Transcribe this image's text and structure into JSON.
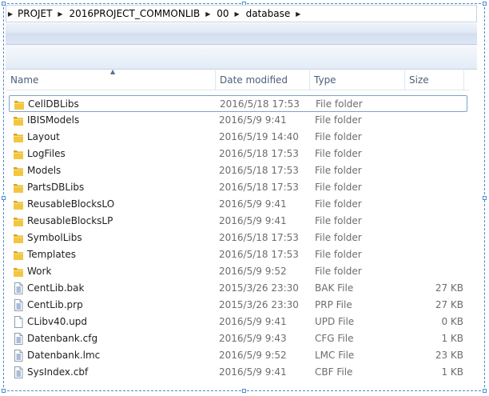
{
  "breadcrumb": [
    {
      "label": "PROJET"
    },
    {
      "label": "2016PROJECT_COMMONLIB"
    },
    {
      "label": "00"
    },
    {
      "label": "database"
    }
  ],
  "columns": {
    "name": "Name",
    "date": "Date modified",
    "type": "Type",
    "size": "Size"
  },
  "files": [
    {
      "name": "CellDBLibs",
      "date": "2016/5/18 17:53",
      "type": "File folder",
      "size": "",
      "icon": "folder-icon"
    },
    {
      "name": "IBISModels",
      "date": "2016/5/9 9:41",
      "type": "File folder",
      "size": "",
      "icon": "folder-icon"
    },
    {
      "name": "Layout",
      "date": "2016/5/19 14:40",
      "type": "File folder",
      "size": "",
      "icon": "folder-icon"
    },
    {
      "name": "LogFiles",
      "date": "2016/5/18 17:53",
      "type": "File folder",
      "size": "",
      "icon": "folder-icon"
    },
    {
      "name": "Models",
      "date": "2016/5/18 17:53",
      "type": "File folder",
      "size": "",
      "icon": "folder-icon"
    },
    {
      "name": "PartsDBLibs",
      "date": "2016/5/18 17:53",
      "type": "File folder",
      "size": "",
      "icon": "folder-icon"
    },
    {
      "name": "ReusableBlocksLO",
      "date": "2016/5/9 9:41",
      "type": "File folder",
      "size": "",
      "icon": "folder-icon"
    },
    {
      "name": "ReusableBlocksLP",
      "date": "2016/5/9 9:41",
      "type": "File folder",
      "size": "",
      "icon": "folder-icon"
    },
    {
      "name": "SymbolLibs",
      "date": "2016/5/18 17:53",
      "type": "File folder",
      "size": "",
      "icon": "folder-icon"
    },
    {
      "name": "Templates",
      "date": "2016/5/18 17:53",
      "type": "File folder",
      "size": "",
      "icon": "folder-icon"
    },
    {
      "name": "Work",
      "date": "2016/5/9 9:52",
      "type": "File folder",
      "size": "",
      "icon": "folder-icon"
    },
    {
      "name": "CentLib.bak",
      "date": "2015/3/26 23:30",
      "type": "BAK File",
      "size": "27 KB",
      "icon": "file-lines-icon"
    },
    {
      "name": "CentLib.prp",
      "date": "2015/3/26 23:30",
      "type": "PRP File",
      "size": "27 KB",
      "icon": "file-lines-icon"
    },
    {
      "name": "CLibv40.upd",
      "date": "2016/5/9 9:41",
      "type": "UPD File",
      "size": "0 KB",
      "icon": "file-blank-icon"
    },
    {
      "name": "Datenbank.cfg",
      "date": "2016/5/9 9:43",
      "type": "CFG File",
      "size": "1 KB",
      "icon": "file-lines-icon"
    },
    {
      "name": "Datenbank.lmc",
      "date": "2016/5/9 9:52",
      "type": "LMC File",
      "size": "23 KB",
      "icon": "file-lines-icon"
    },
    {
      "name": "SysIndex.cbf",
      "date": "2016/5/9 9:41",
      "type": "CBF File",
      "size": "1 KB",
      "icon": "file-lines-icon"
    }
  ],
  "colors": {
    "folder": "#e8b730",
    "selection_border": "#7da2ce",
    "header_text": "#4c607a"
  }
}
